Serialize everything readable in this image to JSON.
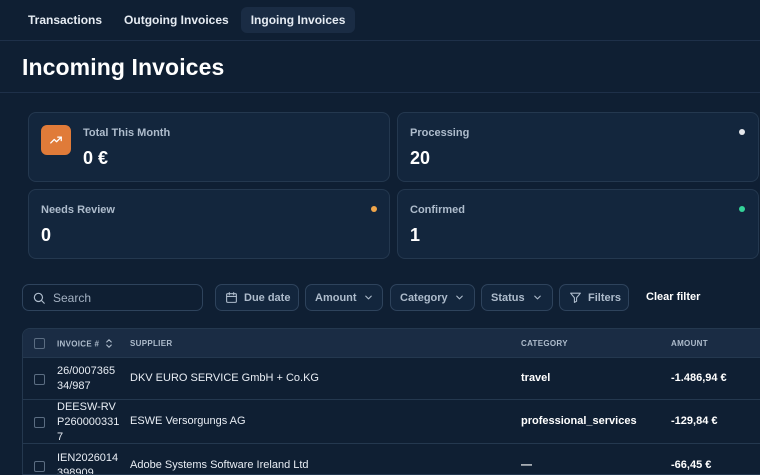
{
  "tabs": [
    {
      "label": "Transactions"
    },
    {
      "label": "Outgoing Invoices"
    },
    {
      "label": "Ingoing Invoices"
    }
  ],
  "page": {
    "title": "Incoming Invoices"
  },
  "stats": {
    "total_this_month": {
      "label": "Total This Month",
      "value": "0 €",
      "icon": "trending-up-icon",
      "color": "#e07b39"
    },
    "processing": {
      "label": "Processing",
      "value": "20",
      "dot_color": "#e5e7eb"
    },
    "needs_review": {
      "label": "Needs Review",
      "value": "0",
      "dot_color": "#f0a54a"
    },
    "confirmed": {
      "label": "Confirmed",
      "value": "1",
      "dot_color": "#34d399"
    }
  },
  "toolbar": {
    "search_placeholder": "Search",
    "due_date": "Due date",
    "amount": "Amount",
    "category": "Category",
    "status": "Status",
    "filters": "Filters",
    "clear_filter": "Clear filter"
  },
  "table": {
    "columns": {
      "invoice": "INVOICE #",
      "supplier": "SUPPLIER",
      "category": "CATEGORY",
      "amount": "AMOUNT"
    },
    "rows": [
      {
        "invoice": "26/000736534/987",
        "supplier": "DKV EURO SERVICE GmbH + Co.KG",
        "category": "travel",
        "amount": "-1.486,94 €"
      },
      {
        "invoice": "DEESW-RVP2600003317",
        "supplier": "ESWE Versorgungs AG",
        "category": "professional_services",
        "amount": "-129,84 €"
      },
      {
        "invoice": "IEN2026014398909",
        "supplier": "Adobe Systems Software Ireland Ltd",
        "category": "—",
        "amount": "-66,45 €"
      }
    ]
  }
}
